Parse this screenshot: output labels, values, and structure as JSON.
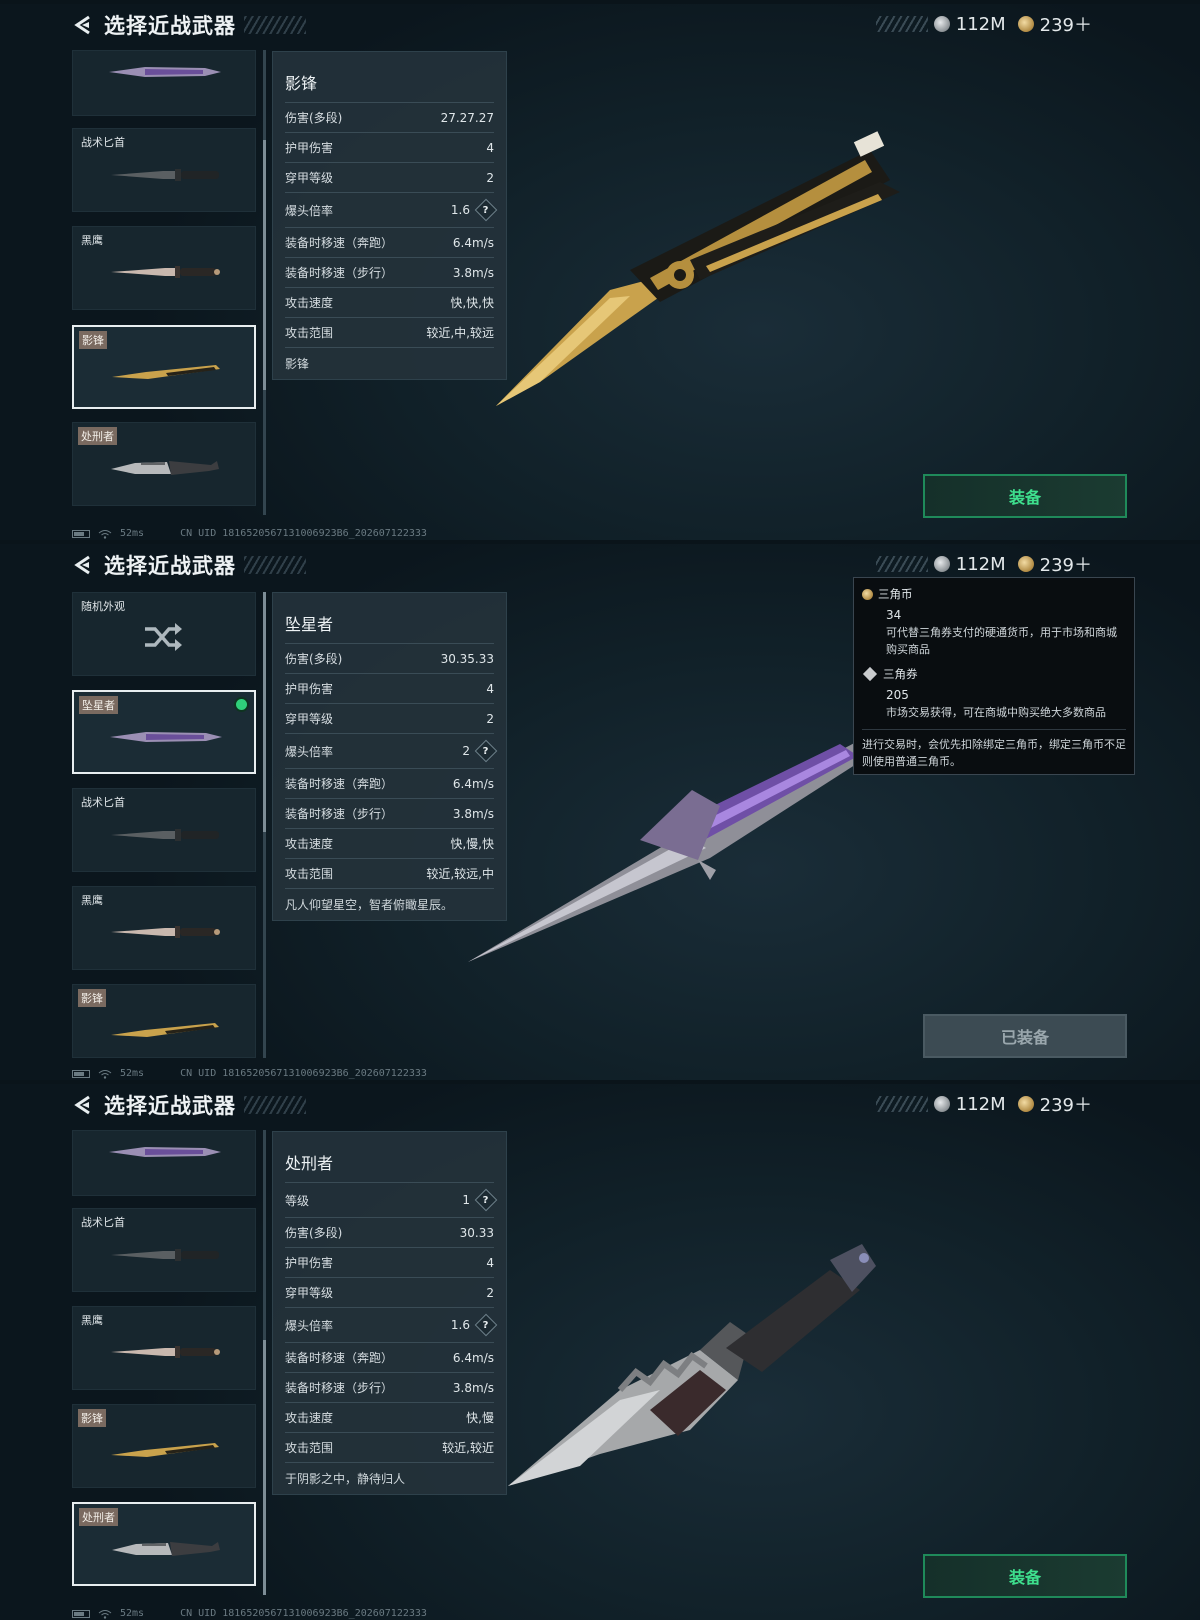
{
  "header": {
    "title": "选择近战武器",
    "currency_silver": "112M",
    "currency_gold": "239＋"
  },
  "footer": {
    "ping": "52ms",
    "uid": "CN UID 1816520567131006923B6_202607122333"
  },
  "panels": [
    {
      "list": [
        {
          "name": ""
        },
        {
          "name": "战术匕首"
        },
        {
          "name": "黑鹰"
        },
        {
          "name": "影锋",
          "selected": true
        },
        {
          "name": "处刑者"
        }
      ],
      "stats": {
        "name": "影锋",
        "rows": [
          {
            "k": "伤害(多段)",
            "v": "27.27.27"
          },
          {
            "k": "护甲伤害",
            "v": "4"
          },
          {
            "k": "穿甲等级",
            "v": "2"
          },
          {
            "k": "爆头倍率",
            "v": "1.6"
          },
          {
            "k": "装备时移速（奔跑）",
            "v": "6.4m/s"
          },
          {
            "k": "装备时移速（步行）",
            "v": "3.8m/s"
          },
          {
            "k": "攻击速度",
            "v": "快,快,快"
          },
          {
            "k": "攻击范围",
            "v": "较近,中,较远"
          }
        ],
        "desc": "影锋"
      },
      "button": "装备"
    },
    {
      "list": [
        {
          "name": "随机外观"
        },
        {
          "name": "坠星者",
          "selected": true
        },
        {
          "name": "战术匕首"
        },
        {
          "name": "黑鹰"
        },
        {
          "name": "影锋"
        }
      ],
      "stats": {
        "name": "坠星者",
        "rows": [
          {
            "k": "伤害(多段)",
            "v": "30.35.33"
          },
          {
            "k": "护甲伤害",
            "v": "4"
          },
          {
            "k": "穿甲等级",
            "v": "2"
          },
          {
            "k": "爆头倍率",
            "v": "2"
          },
          {
            "k": "装备时移速（奔跑）",
            "v": "6.4m/s"
          },
          {
            "k": "装备时移速（步行）",
            "v": "3.8m/s"
          },
          {
            "k": "攻击速度",
            "v": "快,慢,快"
          },
          {
            "k": "攻击范围",
            "v": "较近,较远,中"
          }
        ],
        "desc": "凡人仰望星空，智者俯瞰星辰。"
      },
      "button": "已装备",
      "tooltip": {
        "coin_title": "三角币",
        "coin_value": "34",
        "coin_desc": "可代替三角券支付的硬通货币，用于市场和商城购买商品",
        "ticket_title": "三角券",
        "ticket_value": "205",
        "ticket_desc": "市场交易获得，可在商城中购买绝大多数商品",
        "note": "进行交易时，会优先扣除绑定三角币，绑定三角币不足则使用普通三角币。"
      }
    },
    {
      "list": [
        {
          "name": ""
        },
        {
          "name": "战术匕首"
        },
        {
          "name": "黑鹰"
        },
        {
          "name": "影锋"
        },
        {
          "name": "处刑者",
          "selected": true
        }
      ],
      "stats": {
        "name": "处刑者",
        "rows": [
          {
            "k": "等级",
            "v": "1"
          },
          {
            "k": "伤害(多段)",
            "v": "30.33"
          },
          {
            "k": "护甲伤害",
            "v": "4"
          },
          {
            "k": "穿甲等级",
            "v": "2"
          },
          {
            "k": "爆头倍率",
            "v": "1.6"
          },
          {
            "k": "装备时移速（奔跑）",
            "v": "6.4m/s"
          },
          {
            "k": "装备时移速（步行）",
            "v": "3.8m/s"
          },
          {
            "k": "攻击速度",
            "v": "快,慢"
          },
          {
            "k": "攻击范围",
            "v": "较近,较近"
          }
        ],
        "desc": "于阴影之中，静待归人"
      },
      "button": "装备"
    }
  ]
}
